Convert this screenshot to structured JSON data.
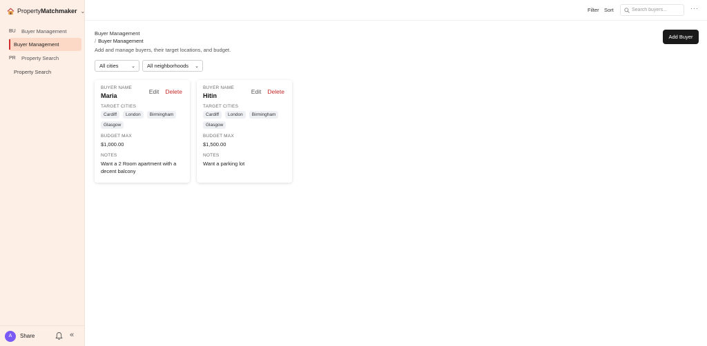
{
  "app": {
    "brand_a": "Property",
    "brand_b": "Matchmaker"
  },
  "sidebar": {
    "groups": [
      {
        "abbr": "BU",
        "label": "Buyer Management"
      },
      {
        "abbr": "PR",
        "label": "Property Search"
      }
    ],
    "items": [
      {
        "label": "Buyer Management",
        "active": true
      },
      {
        "label": "Property Search",
        "active": false
      }
    ],
    "footer": {
      "avatar_letter": "A",
      "share_label": "Share"
    }
  },
  "topbar": {
    "filter_label": "Filter",
    "sort_label": "Sort",
    "search_placeholder": "Search buyers..."
  },
  "page": {
    "breadcrumb_root": "Buyer Management",
    "breadcrumb_sep": "/",
    "breadcrumb_current": "Buyer Management",
    "subtitle": "Add and manage buyers, their target locations, and budget.",
    "add_button": "Add Buyer"
  },
  "filters": {
    "city": "All cities",
    "neighborhood": "All neighborhoods"
  },
  "card_labels": {
    "name": "BUYER NAME",
    "cities": "TARGET CITIES",
    "budget": "BUDGET MAX",
    "notes": "NOTES",
    "edit": "Edit",
    "delete": "Delete"
  },
  "buyers": [
    {
      "name": "Maria",
      "cities": [
        "Cardiff",
        "London",
        "Birmingham",
        "Glasgow"
      ],
      "budget": "$1,000.00",
      "notes": "Want a 2 Room apartment with a decent balcony"
    },
    {
      "name": "Hitin",
      "cities": [
        "Cardiff",
        "London",
        "Birmingham",
        "Glasgow"
      ],
      "budget": "$1,500.00",
      "notes": "Want a parking lot"
    }
  ]
}
